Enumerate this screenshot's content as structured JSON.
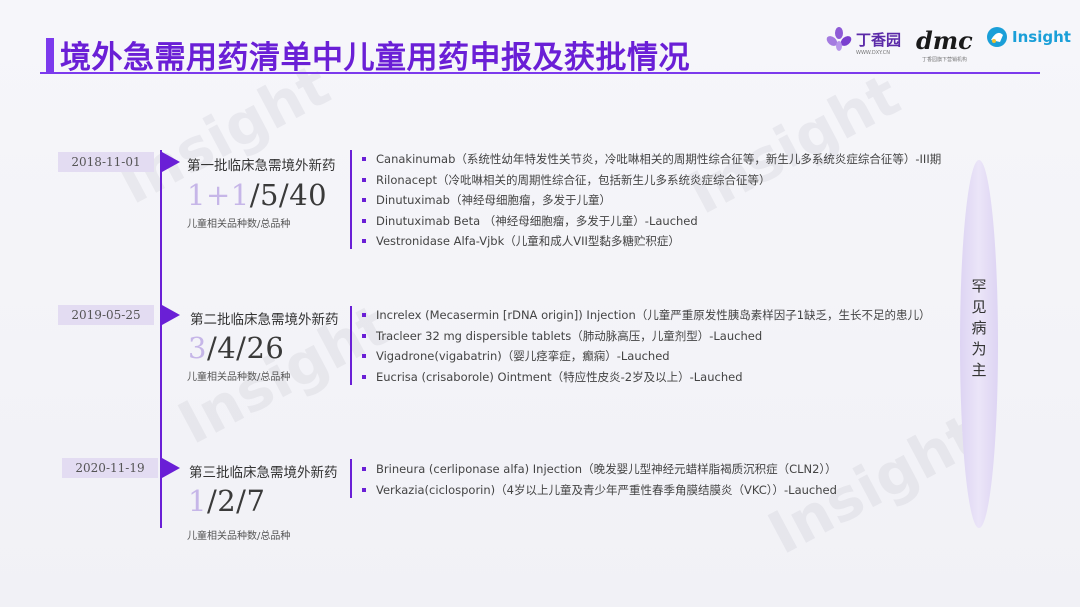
{
  "title": "境外急需用药清单中儿童用药申报及获批情况",
  "logos": {
    "dxy": "丁香园",
    "dxy_sub": "WWW.DXY.CN",
    "dmc": "dmc",
    "dmc_sub": "丁香园旗下营销机构",
    "insight": "Insight"
  },
  "watermark": "Insight",
  "side_label": [
    "罕",
    "见",
    "病",
    "为",
    "主"
  ],
  "batches": [
    {
      "date": "2018-11-01",
      "title": "第一批临床急需境外新药",
      "count_light": "1+1",
      "count_dark": "/5/40",
      "caption": "儿童相关品种数/总品种",
      "drugs": [
        "Canakinumab（系统性幼年特发性关节炎，冷吡啉相关的周期性综合征等，新生儿多系统炎症综合征等）-III期",
        "Rilonacept（冷吡啉相关的周期性综合征，包括新生儿多系统炎症综合征等）",
        "Dinutuximab（神经母细胞瘤，多发于儿童）",
        "Dinutuximab Beta （神经母细胞瘤，多发于儿童）-Lauched",
        "Vestronidase Alfa-Vjbk（儿童和成人VII型黏多糖贮积症）"
      ]
    },
    {
      "date": "2019-05-25",
      "title": "第二批临床急需境外新药",
      "count_light": "3",
      "count_dark": "/4/26",
      "caption": "儿童相关品种数/总品种",
      "drugs": [
        "Increlex (Mecasermin [rDNA origin]) Injection（儿童严重原发性胰岛素样因子1缺乏，生长不足的患儿）",
        "Tracleer 32 mg dispersible tablets（肺动脉高压，儿童剂型）-Lauched",
        "Vigadrone(vigabatrin)（婴儿痉挛症，癫痫）-Lauched",
        "Eucrisa (crisaborole) Ointment（特应性皮炎-2岁及以上）-Lauched"
      ]
    },
    {
      "date": "2020-11-19",
      "title": "第三批临床急需境外新药",
      "count_light": "1",
      "count_dark": "/2/7",
      "caption": "儿童相关品种数/总品种",
      "drugs": [
        "Brineura (cerliponase alfa) Injection（晚发婴儿型神经元蜡样脂褐质沉积症（CLN2））",
        "Verkazia(ciclosporin)（4岁以上儿童及青少年严重性春季角膜结膜炎（VKC））-Lauched"
      ]
    }
  ]
}
